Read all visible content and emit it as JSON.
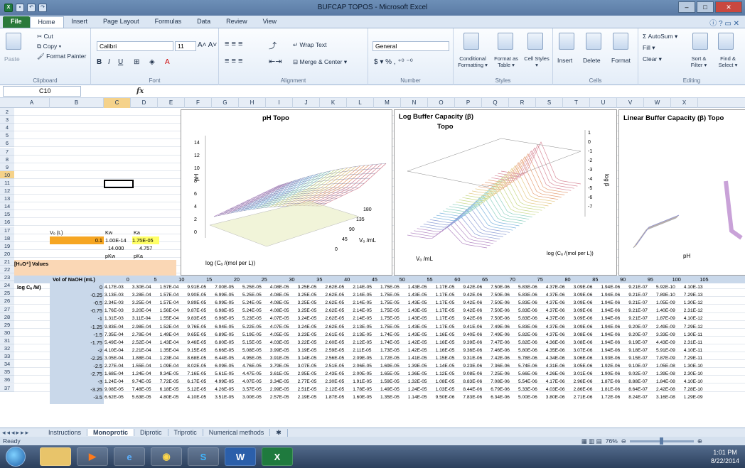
{
  "window": {
    "title": "BUFCAP TOPOS - Microsoft Excel"
  },
  "tabs": [
    "File",
    "Home",
    "Insert",
    "Page Layout",
    "Formulas",
    "Data",
    "Review",
    "View"
  ],
  "ribbon": {
    "clipboard": {
      "paste": "Paste",
      "cut": "Cut",
      "copy": "Copy ▾",
      "format_painter": "Format Painter",
      "label": "Clipboard"
    },
    "font": {
      "name": "Calibri",
      "size": "11",
      "label": "Font"
    },
    "alignment": {
      "wrap": "Wrap Text",
      "merge": "Merge & Center ▾",
      "label": "Alignment"
    },
    "number": {
      "format": "General",
      "label": "Number"
    },
    "styles": {
      "conditional": "Conditional Formatting ▾",
      "format_table": "Format as Table ▾",
      "cell_styles": "Cell Styles ▾",
      "label": "Styles"
    },
    "cells": {
      "insert": "Insert",
      "delete": "Delete",
      "format": "Format",
      "label": "Cells"
    },
    "editing": {
      "autosum": "Σ AutoSum ▾",
      "fill": "Fill ▾",
      "clear": "Clear ▾",
      "sort": "Sort & Filter ▾",
      "find": "Find & Select ▾",
      "label": "Editing"
    }
  },
  "formula_bar": {
    "name_box": "C10",
    "fx": "fx"
  },
  "columns": [
    "A",
    "B",
    "C",
    "D",
    "E",
    "F",
    "G",
    "H",
    "I",
    "J",
    "K",
    "L",
    "M",
    "N",
    "O",
    "P",
    "Q",
    "R",
    "S",
    "T",
    "U",
    "V",
    "W",
    "X"
  ],
  "rows": [
    "2",
    "3",
    "4",
    "5",
    "6",
    "7",
    "8",
    "9",
    "10",
    "11",
    "12",
    "13",
    "14",
    "15",
    "16",
    "17",
    "18",
    "19",
    "20",
    "21",
    "22",
    "23",
    "24",
    "25",
    "26",
    "27",
    "28",
    "29",
    "30",
    "31",
    "32",
    "33",
    "34",
    "35",
    "36",
    "37"
  ],
  "cells": {
    "r15_b": "Vₒ (L)",
    "r15_c": "Kw",
    "r15_d": "Ka",
    "r16_b": "0.1",
    "r16_c": "1.00E-14",
    "r16_d": "1.75E-05",
    "r17_c": "14.000",
    "r17_d": "4.757",
    "r18_c": "pKw",
    "r18_d": "pKa",
    "r19_a": "[H₃O⁺] Values",
    "r21_b": "Vol of NaOH (mL)",
    "r22_a": "log Cₐ /M)"
  },
  "vol_headers": [
    "0",
    "5",
    "10",
    "15",
    "20",
    "25",
    "30",
    "35",
    "40",
    "45",
    "50",
    "55",
    "60",
    "65",
    "70",
    "75",
    "80",
    "85",
    "90",
    "95",
    "100",
    "105"
  ],
  "log_c": [
    "0",
    "-0.25",
    "-0.5",
    "-0.75",
    "-1",
    "-1.25",
    "-1.5",
    "-1.75",
    "-2",
    "-2.25",
    "-2.5",
    "-2.75",
    "-3",
    "-3.25",
    "-3.5"
  ],
  "table_rows": [
    [
      "4.17E-03",
      "3.30E-04",
      "1.57E-04",
      "9.91E-05",
      "7.00E-05",
      "5.25E-05",
      "4.08E-05",
      "3.25E-05",
      "2.62E-05",
      "2.14E-05",
      "1.75E-05",
      "1.43E-05",
      "1.17E-05",
      "9.42E-06",
      "7.50E-06",
      "5.83E-06",
      "4.37E-06",
      "3.09E-06",
      "1.94E-06",
      "9.21E-07",
      "5.92E-10",
      "4.10E-13"
    ],
    [
      "3.13E-03",
      "3.28E-04",
      "1.57E-04",
      "9.90E-05",
      "6.99E-05",
      "5.25E-05",
      "4.08E-05",
      "3.25E-05",
      "2.62E-05",
      "2.14E-05",
      "1.75E-05",
      "1.43E-05",
      "1.17E-05",
      "9.42E-06",
      "7.50E-06",
      "5.83E-06",
      "4.37E-06",
      "3.09E-06",
      "1.94E-06",
      "9.21E-07",
      "7.89E-10",
      "7.29E-13"
    ],
    [
      "2.34E-03",
      "3.25E-04",
      "1.57E-04",
      "9.89E-05",
      "6.99E-05",
      "5.24E-05",
      "4.08E-05",
      "3.25E-05",
      "2.62E-05",
      "2.14E-05",
      "1.75E-05",
      "1.43E-05",
      "1.17E-05",
      "9.42E-06",
      "7.50E-06",
      "5.83E-06",
      "4.37E-06",
      "3.09E-06",
      "1.94E-06",
      "9.21E-07",
      "1.05E-09",
      "1.30E-12"
    ],
    [
      "1.76E-03",
      "3.20E-04",
      "1.56E-04",
      "9.87E-05",
      "6.98E-05",
      "5.24E-05",
      "4.08E-05",
      "3.25E-05",
      "2.62E-05",
      "2.14E-05",
      "1.75E-05",
      "1.43E-05",
      "1.17E-05",
      "9.42E-06",
      "7.50E-06",
      "5.83E-06",
      "4.37E-06",
      "3.09E-06",
      "1.94E-06",
      "9.21E-07",
      "1.40E-09",
      "2.31E-12"
    ],
    [
      "1.31E-03",
      "3.11E-04",
      "1.55E-04",
      "9.83E-05",
      "6.96E-05",
      "5.23E-05",
      "4.07E-05",
      "3.24E-05",
      "2.62E-05",
      "2.14E-05",
      "1.75E-05",
      "1.43E-05",
      "1.17E-05",
      "9.42E-06",
      "7.50E-06",
      "5.83E-06",
      "4.37E-06",
      "3.09E-06",
      "1.94E-06",
      "9.21E-07",
      "1.87E-09",
      "4.10E-12"
    ],
    [
      "9.83E-04",
      "2.98E-04",
      "1.52E-04",
      "9.76E-05",
      "6.94E-05",
      "5.22E-05",
      "4.07E-05",
      "3.24E-05",
      "2.62E-05",
      "2.13E-05",
      "1.75E-05",
      "1.43E-05",
      "1.17E-05",
      "9.41E-06",
      "7.49E-06",
      "5.83E-06",
      "4.37E-06",
      "3.09E-06",
      "1.94E-06",
      "9.20E-07",
      "2.49E-09",
      "7.29E-12"
    ],
    [
      "7.35E-04",
      "2.78E-04",
      "1.49E-04",
      "9.65E-05",
      "6.89E-05",
      "5.19E-05",
      "4.05E-05",
      "3.23E-05",
      "2.61E-05",
      "2.13E-05",
      "1.74E-05",
      "1.43E-05",
      "1.16E-05",
      "9.40E-06",
      "7.49E-06",
      "5.82E-06",
      "4.37E-06",
      "3.08E-06",
      "1.94E-06",
      "9.20E-07",
      "3.33E-09",
      "1.30E-11"
    ],
    [
      "5.49E-04",
      "2.52E-04",
      "1.43E-04",
      "9.46E-05",
      "6.80E-05",
      "5.15E-05",
      "4.03E-05",
      "3.22E-05",
      "2.60E-05",
      "2.12E-05",
      "1.74E-05",
      "1.42E-05",
      "1.16E-05",
      "9.39E-06",
      "7.47E-06",
      "5.82E-06",
      "4.36E-06",
      "3.08E-06",
      "1.94E-06",
      "9.19E-07",
      "4.43E-09",
      "2.31E-11"
    ],
    [
      "4.10E-04",
      "2.21E-04",
      "1.35E-04",
      "9.15E-05",
      "6.66E-05",
      "5.08E-05",
      "3.99E-05",
      "3.19E-05",
      "2.59E-05",
      "2.11E-05",
      "1.73E-05",
      "1.42E-05",
      "1.16E-05",
      "9.36E-06",
      "7.46E-06",
      "5.80E-06",
      "4.35E-06",
      "3.07E-06",
      "1.94E-06",
      "9.18E-07",
      "5.91E-09",
      "4.10E-11"
    ],
    [
      "3.05E-04",
      "1.88E-04",
      "1.23E-04",
      "8.68E-05",
      "6.44E-05",
      "4.95E-05",
      "3.91E-05",
      "3.14E-05",
      "2.56E-05",
      "2.09E-05",
      "1.72E-05",
      "1.41E-05",
      "1.15E-05",
      "9.31E-06",
      "7.42E-06",
      "5.78E-06",
      "4.34E-06",
      "3.06E-06",
      "1.93E-06",
      "9.15E-07",
      "7.87E-09",
      "7.29E-11"
    ],
    [
      "2.27E-04",
      "1.55E-04",
      "1.09E-04",
      "8.02E-05",
      "6.09E-05",
      "4.76E-05",
      "3.79E-05",
      "3.07E-05",
      "2.51E-05",
      "2.06E-05",
      "1.69E-05",
      "1.39E-05",
      "1.14E-05",
      "9.23E-06",
      "7.36E-06",
      "5.74E-06",
      "4.31E-06",
      "3.05E-06",
      "1.92E-06",
      "9.10E-07",
      "1.05E-08",
      "1.30E-10"
    ],
    [
      "1.68E-04",
      "1.24E-04",
      "9.34E-05",
      "7.16E-05",
      "5.61E-05",
      "4.47E-05",
      "3.61E-05",
      "2.95E-05",
      "2.43E-05",
      "2.00E-05",
      "1.65E-05",
      "1.36E-05",
      "1.12E-05",
      "9.08E-06",
      "7.25E-06",
      "5.66E-06",
      "4.26E-06",
      "3.01E-06",
      "1.90E-06",
      "9.02E-07",
      "1.39E-08",
      "2.30E-10"
    ],
    [
      "1.24E-04",
      "9.74E-05",
      "7.72E-05",
      "6.17E-05",
      "4.99E-05",
      "4.07E-05",
      "3.34E-05",
      "2.77E-05",
      "2.30E-05",
      "1.91E-05",
      "1.59E-05",
      "1.32E-05",
      "1.08E-05",
      "8.83E-06",
      "7.08E-06",
      "5.54E-06",
      "4.17E-06",
      "2.96E-06",
      "1.87E-06",
      "8.88E-07",
      "1.84E-08",
      "4.10E-10"
    ],
    [
      "9.08E-05",
      "7.48E-05",
      "6.18E-05",
      "5.12E-05",
      "4.26E-05",
      "3.57E-05",
      "2.99E-05",
      "2.51E-05",
      "2.12E-05",
      "1.78E-05",
      "1.49E-05",
      "1.24E-05",
      "1.03E-05",
      "8.44E-06",
      "6.79E-06",
      "5.33E-06",
      "4.03E-06",
      "2.86E-06",
      "1.81E-06",
      "8.64E-07",
      "2.42E-08",
      "7.28E-10"
    ],
    [
      "6.62E-05",
      "5.63E-05",
      "4.80E-05",
      "4.10E-05",
      "3.51E-05",
      "3.00E-05",
      "2.57E-05",
      "2.19E-05",
      "1.87E-05",
      "1.60E-05",
      "1.35E-05",
      "1.14E-05",
      "9.50E-06",
      "7.83E-06",
      "6.34E-06",
      "5.00E-06",
      "3.80E-06",
      "2.71E-06",
      "1.72E-06",
      "8.24E-07",
      "3.16E-08",
      "1.29E-09"
    ]
  ],
  "charts": {
    "ph": {
      "title": "pH Topo",
      "zlabel": "pH",
      "xlabel": "log (Cₐ /(mol per L))",
      "ylabel": "Vₒ /mL",
      "zticks": [
        "14",
        "12",
        "10",
        "8",
        "6",
        "4",
        "2",
        "0"
      ],
      "yticks": [
        "180",
        "135",
        "90",
        "45",
        "0"
      ]
    },
    "logbeta": {
      "title": "Log Buffer Capacity (β)",
      "subtitle": "Topo",
      "zlabel": "log β",
      "xlabel": "Vₒ /mL",
      "ylabel": "log (Cₐ /(mol per L))",
      "zticks": [
        "1",
        "0",
        "-1",
        "-2",
        "-3",
        "-4",
        "-5",
        "-6",
        "-7"
      ]
    },
    "linbeta": {
      "title": "Linear Buffer Capacity (β) Topo",
      "xlabel": "pH"
    }
  },
  "sheets": [
    "Instructions",
    "Monoprotic",
    "Diprotic",
    "Triprotic",
    "Numerical methods"
  ],
  "status": {
    "ready": "Ready",
    "zoom": "76%"
  },
  "clock": {
    "time": "1:01 PM",
    "date": "8/22/2014"
  }
}
